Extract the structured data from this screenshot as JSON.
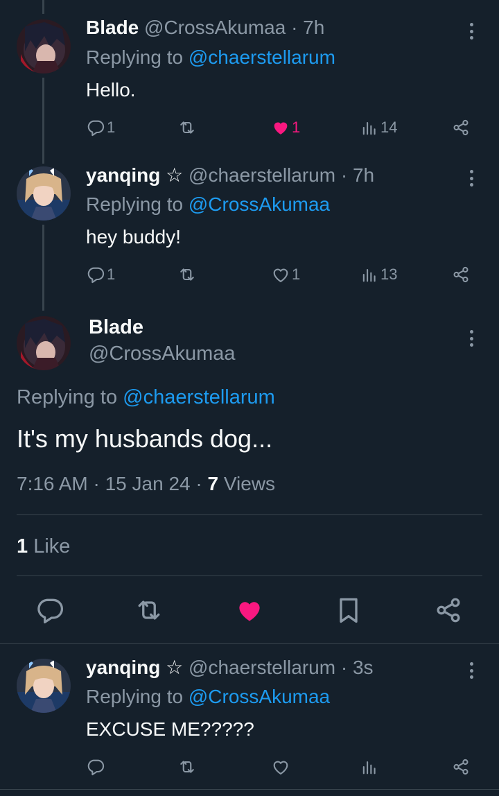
{
  "tweets": [
    {
      "name": "Blade",
      "handle": "@CrossAkumaa",
      "time": "· 7h",
      "replying_prefix": "Replying to",
      "replying_to": "@chaerstellarum",
      "text": "Hello.",
      "replies": "1",
      "likes": "1",
      "views": "14",
      "liked": true,
      "avatar": "blade-avatar"
    },
    {
      "name": "yanqing",
      "badge": "☆",
      "handle": "@chaerstellarum",
      "time": "· 7h",
      "replying_prefix": "Replying to",
      "replying_to": "@CrossAkumaa",
      "text": "hey buddy!",
      "replies": "1",
      "likes": "1",
      "views": "13",
      "liked": false,
      "avatar": "yanqing-avatar"
    }
  ],
  "focused": {
    "name": "Blade",
    "handle": "@CrossAkumaa",
    "replying_prefix": "Replying to",
    "replying_to": "@chaerstellarum",
    "text": "It's my husbands dog...",
    "time": "7:16 AM · 15 Jan 24 ·",
    "views_count": "7",
    "views_label": "Views",
    "likes_count": "1",
    "likes_label": "Like",
    "liked": true
  },
  "reply": {
    "name": "yanqing",
    "badge": "☆",
    "handle": "@chaerstellarum",
    "time": "· 3s",
    "replying_prefix": "Replying to",
    "replying_to": "@CrossAkumaa",
    "text": "EXCUSE ME?????"
  },
  "colors": {
    "background": "#15202b",
    "text": "#f7f9f9",
    "muted": "#8b98a5",
    "link": "#1d9bf0",
    "like": "#f91880",
    "divider": "#38444d"
  },
  "icons": [
    "reply-icon",
    "retweet-icon",
    "heart-icon",
    "views-icon",
    "share-icon",
    "bookmark-icon",
    "more-icon"
  ]
}
